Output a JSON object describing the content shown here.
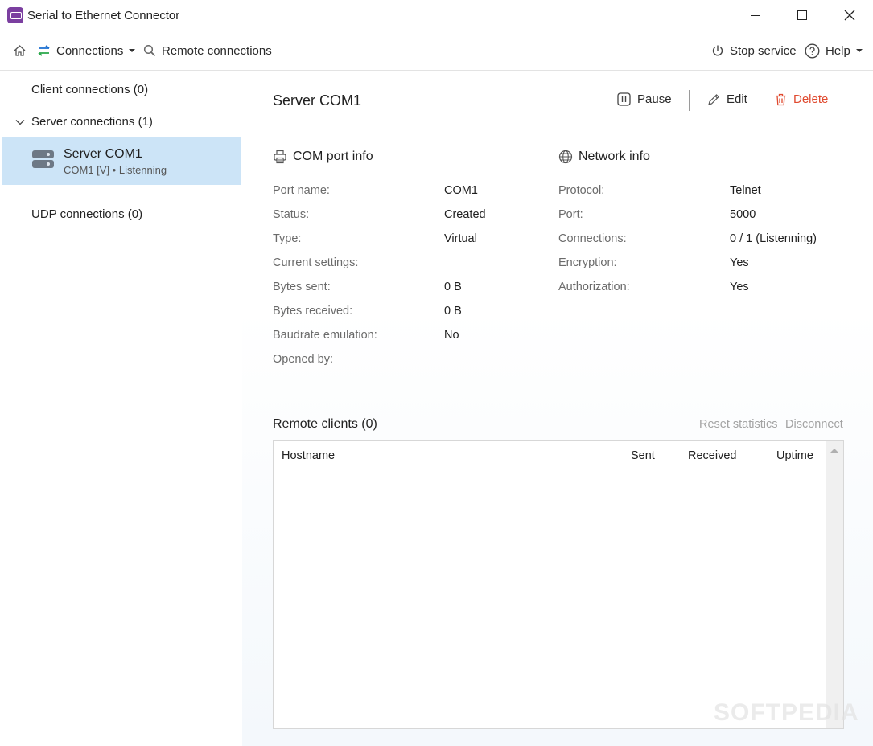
{
  "window": {
    "title": "Serial to Ethernet Connector"
  },
  "toolbar": {
    "connections_label": "Connections",
    "remote_label": "Remote connections",
    "stop_label": "Stop service",
    "help_label": "Help"
  },
  "sidebar": {
    "client_label": "Client connections (0)",
    "server_group_label": "Server connections (1)",
    "selected_item": {
      "name": "Server COM1",
      "subtitle": "COM1 [V] • Listenning"
    },
    "udp_label": "UDP connections (0)"
  },
  "main": {
    "title": "Server COM1",
    "actions": {
      "pause": "Pause",
      "edit": "Edit",
      "delete": "Delete"
    },
    "com_info": {
      "title": "COM port info",
      "rows": [
        {
          "label": "Port name:",
          "value": "COM1"
        },
        {
          "label": "Status:",
          "value": "Created"
        },
        {
          "label": "Type:",
          "value": "Virtual"
        },
        {
          "label": "Current settings:",
          "value": ""
        },
        {
          "label": "Bytes sent:",
          "value": "0 B"
        },
        {
          "label": "Bytes received:",
          "value": "0 B"
        },
        {
          "label": "Baudrate emulation:",
          "value": "No"
        },
        {
          "label": "Opened by:",
          "value": ""
        }
      ]
    },
    "net_info": {
      "title": "Network info",
      "rows": [
        {
          "label": "Protocol:",
          "value": "Telnet"
        },
        {
          "label": "Port:",
          "value": "5000"
        },
        {
          "label": "Connections:",
          "value": "0 / 1 (Listenning)"
        },
        {
          "label": "Encryption:",
          "value": "Yes"
        },
        {
          "label": "Authorization:",
          "value": "Yes"
        }
      ]
    },
    "remote_clients": {
      "title": "Remote clients (0)",
      "reset_label": "Reset statistics",
      "disconnect_label": "Disconnect",
      "columns": [
        "Hostname",
        "Sent",
        "Received",
        "Uptime"
      ]
    }
  },
  "watermark": "SOFTPEDIA"
}
